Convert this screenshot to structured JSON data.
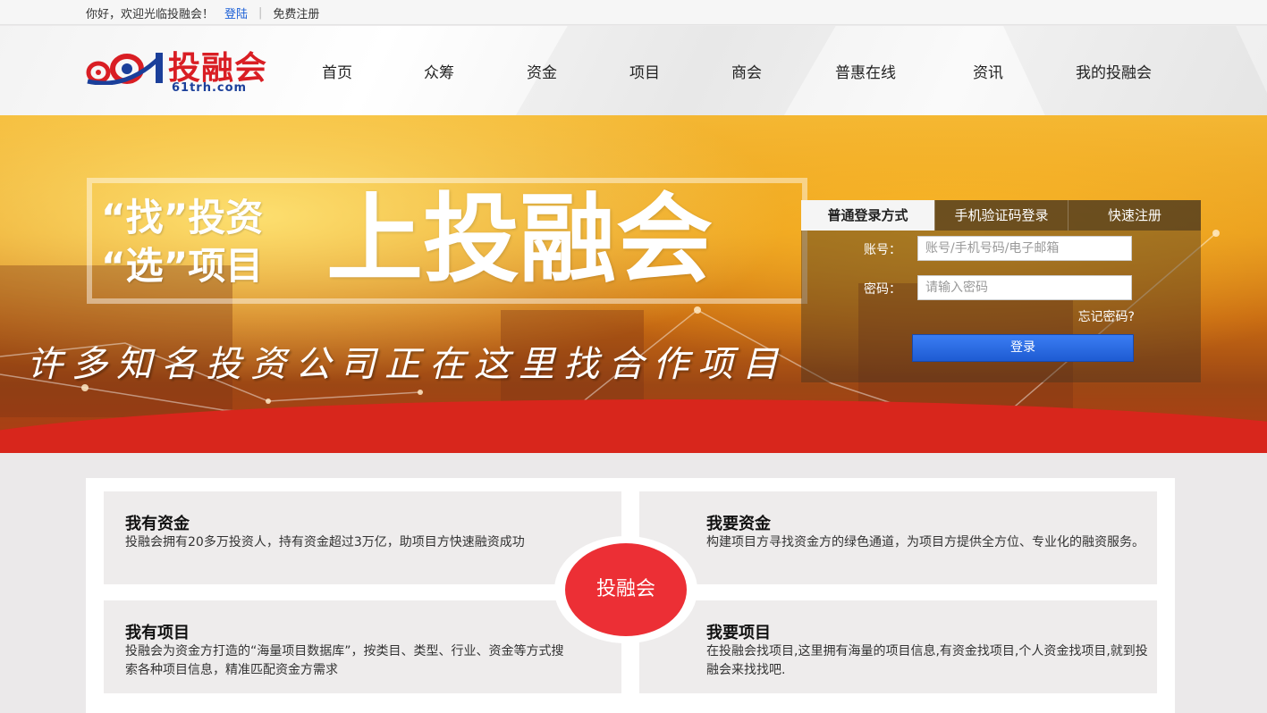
{
  "topbar": {
    "welcome": "你好，欢迎光临投融会！",
    "login": "登陆",
    "separator": "|",
    "register": "免费注册"
  },
  "logo": {
    "brand": "投融会",
    "domain": "61trh.com"
  },
  "nav": {
    "items": [
      "首页",
      "众筹",
      "资金",
      "项目",
      "商会",
      "普惠在线",
      "资讯",
      "我的投融会"
    ]
  },
  "banner": {
    "slogan_line1": "“找”投资",
    "slogan_line2": "“选”项目",
    "slogan_big": "上投融会",
    "tagline": "许多知名投资公司正在这里找合作项目"
  },
  "login": {
    "tabs": [
      "普通登录方式",
      "手机验证码登录",
      "快速注册"
    ],
    "account_label": "账号：",
    "account_placeholder": "账号/手机号码/电子邮箱",
    "password_label": "密码：",
    "password_placeholder": "请输入密码",
    "forgot": "忘记密码?",
    "submit": "登录"
  },
  "services": {
    "center": "投融会",
    "cards": [
      {
        "title": "我有资金",
        "desc": "投融会拥有20多万投资人，持有资金超过3万亿，助项目方快速融资成功"
      },
      {
        "title": "我要资金",
        "desc": "构建项目方寻找资金方的绿色通道，为项目方提供全方位、专业化的融资服务。"
      },
      {
        "title": "我有项目",
        "desc": "投融会为资金方打造的“海量项目数据库”，按类目、类型、行业、资金等方式搜索各种项目信息，精准匹配资金方需求"
      },
      {
        "title": "我要项目",
        "desc": "在投融会找项目,这里拥有海量的项目信息,有资金找项目,个人资金找项目,就到投融会来找找吧."
      }
    ]
  },
  "colors": {
    "brand_red": "#d91e24",
    "brand_blue": "#1b3f9a",
    "link_blue": "#1a5fd6",
    "button_blue": "#1e5bd2",
    "center_red": "#ec2f35"
  }
}
